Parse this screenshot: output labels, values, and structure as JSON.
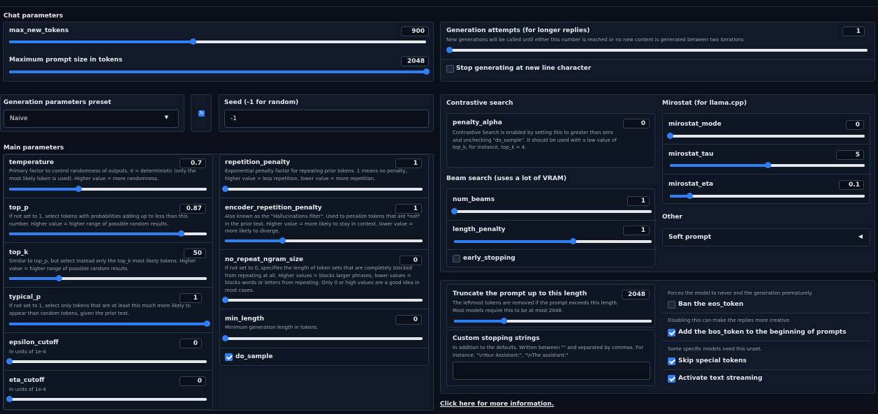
{
  "chat_parameters": {
    "title": "Chat parameters",
    "max_new_tokens": {
      "label": "max_new_tokens",
      "value": "900",
      "fraction": 0.44
    },
    "max_prompt": {
      "label": "Maximum prompt size in tokens",
      "value": "2048",
      "fraction": 1.0
    }
  },
  "generation_attempts": {
    "label": "Generation attempts (for longer replies)",
    "info": "New generations will be called until either this number is reached or no new content is generated between two iterations",
    "value": "1",
    "fraction": 0.0,
    "stop_newline": {
      "label": "Stop generating at new line character",
      "checked": false
    }
  },
  "preset": {
    "label": "Generation parameters preset",
    "value": "Naive",
    "refresh_icon": "refresh-icon"
  },
  "seed": {
    "label": "Seed (-1 for random)",
    "value": "-1"
  },
  "main_parameters": {
    "title": "Main parameters",
    "temperature": {
      "label": "temperature",
      "value": "0.7",
      "fraction": 0.35,
      "info": "Primary factor to control randomness of outputs. 0 = deterministic (only the most likely token is used). Higher value = more randomness."
    },
    "top_p": {
      "label": "top_p",
      "value": "0.87",
      "fraction": 0.87,
      "info": "If not set to 1, select tokens with probabilities adding up to less than this number. Higher value = higher range of possible random results."
    },
    "top_k": {
      "label": "top_k",
      "value": "50",
      "fraction": 0.25,
      "info": "Similar to top_p, but select instead only the top_k most likely tokens. Higher value = higher range of possible random results."
    },
    "typical_p": {
      "label": "typical_p",
      "value": "1",
      "fraction": 1.0,
      "info": "If not set to 1, select only tokens that are at least this much more likely to appear than random tokens, given the prior text."
    },
    "epsilon_cutoff": {
      "label": "epsilon_cutoff",
      "value": "0",
      "fraction": 0.0,
      "info": "In units of 1e-4"
    },
    "eta_cutoff": {
      "label": "eta_cutoff",
      "value": "0",
      "fraction": 0.0,
      "info": "In units of 1e-4"
    },
    "repetition_penalty": {
      "label": "repetition_penalty",
      "value": "1",
      "fraction": 0.0,
      "info": "Exponential penalty factor for repeating prior tokens. 1 means no penalty, higher value = less repetition, lower value = more repetition."
    },
    "encoder_repetition_penalty": {
      "label": "encoder_repetition_penalty",
      "value": "1",
      "fraction": 0.29,
      "info": "Also known as the \"Hallucinations filter\". Used to penalize tokens that are *not* in the prior text. Higher value = more likely to stay in context, lower value = more likely to diverge."
    },
    "no_repeat_ngram_size": {
      "label": "no_repeat_ngram_size",
      "value": "0",
      "fraction": 0.0,
      "info": "If not set to 0, specifies the length of token sets that are completely blocked from repeating at all. Higher values = blocks larger phrases, lower values = blocks words or letters from repeating. Only 0 or high values are a good idea in most cases."
    },
    "min_length": {
      "label": "min_length",
      "value": "0",
      "fraction": 0.0,
      "info": "Minimum generation length in tokens."
    },
    "do_sample": {
      "label": "do_sample",
      "checked": true
    }
  },
  "contrastive": {
    "title": "Contrastive search",
    "penalty_alpha": {
      "label": "penalty_alpha",
      "value": "0",
      "info": "Contrastive Search is enabled by setting this to greater than zero and unchecking \"do_sample\". It should be used with a low value of top_k, for instance, top_k = 4."
    }
  },
  "beam": {
    "title": "Beam search (uses a lot of VRAM)",
    "num_beams": {
      "label": "num_beams",
      "value": "1",
      "fraction": 0.0
    },
    "length_penalty": {
      "label": "length_penalty",
      "value": "1",
      "fraction": 0.6
    },
    "early_stopping": {
      "label": "early_stopping",
      "checked": false
    }
  },
  "mirostat": {
    "title": "Mirostat (for llama.cpp)",
    "mode": {
      "label": "mirostat_mode",
      "value": "0",
      "fraction": 0.0
    },
    "tau": {
      "label": "mirostat_tau",
      "value": "5",
      "fraction": 0.5
    },
    "eta": {
      "label": "mirostat_eta",
      "value": "0.1",
      "fraction": 0.1
    }
  },
  "other": {
    "title": "Other",
    "soft_prompt": {
      "label": "Soft prompt",
      "icon": "caret-left-icon"
    }
  },
  "truncate": {
    "label": "Truncate the prompt up to this length",
    "value": "2048",
    "fraction": 0.25,
    "info": "The leftmost tokens are removed if the prompt exceeds this length. Most models require this to be at most 2048."
  },
  "stopping": {
    "label": "Custom stopping strings",
    "info": "In addition to the defaults. Written between \"\" and separated by commas. For instance: \"\\nYour Assistant:\", \"\\nThe assistant:\"",
    "value": ""
  },
  "flags": {
    "ban_eos": {
      "info": "Forces the model to never end the generation prematurely.",
      "label": "Ban the eos_token",
      "checked": false
    },
    "add_bos": {
      "info": "Disabling this can make the replies more creative.",
      "label": "Add the bos_token to the beginning of prompts",
      "checked": true
    },
    "skip_special": {
      "info": "Some specific models need this unset.",
      "label": "Skip special tokens",
      "checked": true
    },
    "streaming": {
      "label": "Activate text streaming",
      "checked": true
    }
  },
  "more_info_link": "Click here for more information.",
  "colors": {
    "accent": "#2f7ff4",
    "background": "#0b0f19",
    "panel": "#111827"
  }
}
